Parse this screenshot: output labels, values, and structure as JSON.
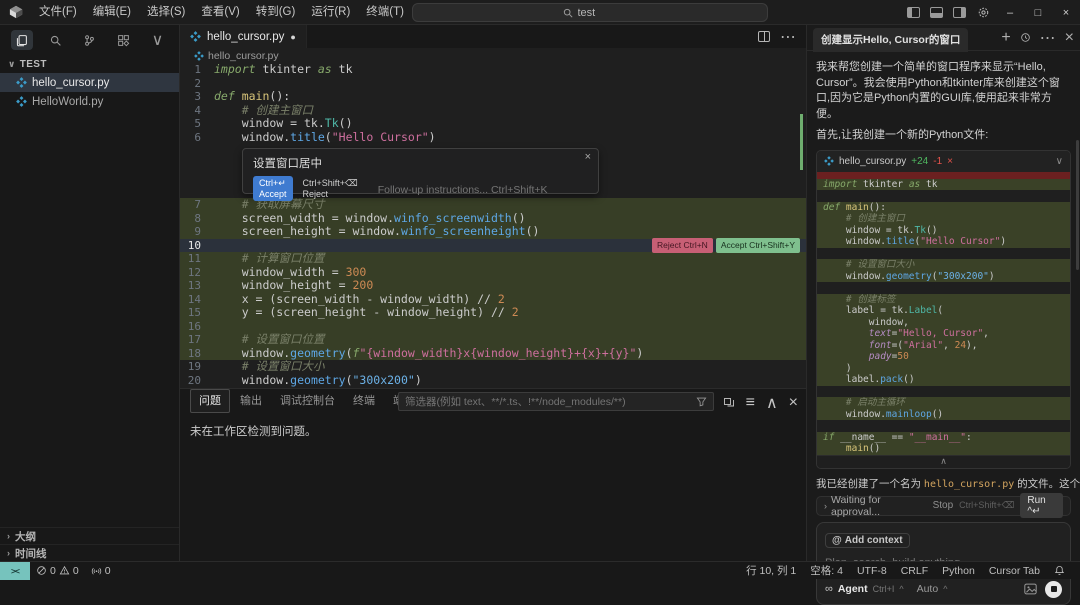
{
  "icons": {
    "close": "×",
    "ellipsis": "⋯",
    "back": "←",
    "forward": "→",
    "minimize": "–",
    "maximize": "□",
    "collapse_up": "∧",
    "chevron_down": "∨",
    "chevron_right": "›",
    "list": "≡",
    "plus": "+",
    "modified_dot": "●",
    "at": "@",
    "infinity": "∞",
    "caret_up": "^",
    "remote": "><"
  },
  "titlebar": {
    "menus": [
      "文件(F)",
      "编辑(E)",
      "选择(S)",
      "查看(V)",
      "转到(G)",
      "运行(R)",
      "终端(T)",
      "⋯"
    ],
    "search_text": "test"
  },
  "sidebar": {
    "explorer_label": "TEST",
    "files": [
      {
        "name": "hello_cursor.py",
        "selected": true
      },
      {
        "name": "HelloWorld.py",
        "selected": false
      }
    ],
    "bottom_sections": [
      "大纲",
      "时间线"
    ]
  },
  "editor": {
    "tab_label": "hello_cursor.py",
    "breadcrumb": "hello_cursor.py",
    "widget": {
      "title": "设置窗口居中",
      "accept_label": "Ctrl+↵ Accept",
      "reject_label": "Ctrl+Shift+⌫ Reject",
      "input_placeholder": "Follow-up instructions... Ctrl+Shift+K"
    },
    "lines_before": [
      {
        "n": 1,
        "t": [
          [
            "kw",
            "import"
          ],
          [
            "txt",
            " tkinter "
          ],
          [
            "kw",
            "as"
          ],
          [
            "txt",
            " tk"
          ]
        ]
      },
      {
        "n": 2,
        "t": []
      },
      {
        "n": 3,
        "t": [
          [
            "kw",
            "def "
          ],
          [
            "fn",
            "main"
          ],
          [
            "txt",
            "():"
          ]
        ]
      },
      {
        "n": 4,
        "t": [
          [
            "com",
            "    # 创建主窗口"
          ]
        ]
      },
      {
        "n": 5,
        "t": [
          [
            "txt",
            "    window = tk."
          ],
          [
            "cls",
            "Tk"
          ],
          [
            "txt",
            "()"
          ]
        ]
      },
      {
        "n": 6,
        "t": [
          [
            "txt",
            "    window."
          ],
          [
            "meth",
            "title"
          ],
          [
            "txt",
            "("
          ],
          [
            "str",
            "\"Hello Cursor\""
          ],
          [
            "txt",
            ")"
          ]
        ]
      }
    ],
    "lines_after": [
      {
        "n": 7,
        "f": "a",
        "t": [
          [
            "com",
            "    # 获取屏幕尺寸"
          ]
        ]
      },
      {
        "n": 8,
        "f": "a",
        "t": [
          [
            "txt",
            "    screen_width = window."
          ],
          [
            "meth",
            "winfo_screenwidth"
          ],
          [
            "txt",
            "()"
          ]
        ]
      },
      {
        "n": 9,
        "f": "a",
        "t": [
          [
            "txt",
            "    screen_height = window."
          ],
          [
            "meth",
            "winfo_screenheight"
          ],
          [
            "txt",
            "()"
          ]
        ]
      },
      {
        "n": 10,
        "f": "ac",
        "t": [],
        "b": [
          {
            "k": "reject",
            "label": "Reject Ctrl+N"
          },
          {
            "k": "accept",
            "label": "Accept Ctrl+Shift+Y"
          }
        ]
      },
      {
        "n": 11,
        "f": "a",
        "t": [
          [
            "com",
            "    # 计算窗口位置"
          ]
        ]
      },
      {
        "n": 12,
        "f": "a",
        "t": [
          [
            "txt",
            "    window_width = "
          ],
          [
            "num",
            "300"
          ]
        ]
      },
      {
        "n": 13,
        "f": "a",
        "t": [
          [
            "txt",
            "    window_height = "
          ],
          [
            "num",
            "200"
          ]
        ]
      },
      {
        "n": 14,
        "f": "a",
        "t": [
          [
            "txt",
            "    x = (screen_width - window_width) // "
          ],
          [
            "num",
            "2"
          ]
        ]
      },
      {
        "n": 15,
        "f": "a",
        "t": [
          [
            "txt",
            "    y = (screen_height - window_height) // "
          ],
          [
            "num",
            "2"
          ]
        ]
      },
      {
        "n": 16,
        "f": "a",
        "t": []
      },
      {
        "n": 17,
        "f": "a",
        "t": [
          [
            "com",
            "    # 设置窗口位置"
          ]
        ]
      },
      {
        "n": 18,
        "f": "a",
        "t": [
          [
            "txt",
            "    window."
          ],
          [
            "meth",
            "geometry"
          ],
          [
            "txt",
            "("
          ],
          [
            "kw",
            "f"
          ],
          [
            "str",
            "\"{window_width}x{window_height}+{x}+{y}\""
          ],
          [
            "txt",
            ")"
          ]
        ]
      },
      {
        "n": 19,
        "f": "",
        "t": [
          [
            "com",
            "    # 设置窗口大小"
          ]
        ]
      },
      {
        "n": 20,
        "f": "",
        "t": [
          [
            "txt",
            "    window."
          ],
          [
            "meth",
            "geometry"
          ],
          [
            "txt",
            "("
          ],
          [
            "str2",
            "\"300x200\""
          ],
          [
            "txt",
            ")"
          ]
        ]
      }
    ]
  },
  "panel": {
    "tabs": [
      {
        "label": "问题",
        "active": true
      },
      {
        "label": "输出",
        "active": false
      },
      {
        "label": "调试控制台",
        "active": false
      },
      {
        "label": "终端",
        "active": false
      },
      {
        "label": "端口",
        "active": false
      }
    ],
    "filter_placeholder": "筛选器(例如 text、**/*.ts、!**/node_modules/**)",
    "message": "未在工作区检测到问题。"
  },
  "chat": {
    "tab_title": "创建显示Hello, Cursor的窗口",
    "p1": "我来帮您创建一个简单的窗口程序来显示“Hello, Cursor”。我会使用Python和tkinter库来创建这个窗口,因为它是Python内置的GUI库,使用起来非常方便。",
    "p2": "首先,让我创建一个新的Python文件:",
    "code_card": {
      "filename": "hello_cursor.py",
      "added": "+24",
      "removed": "-1",
      "close": "×"
    },
    "code_lines": [
      {
        "f": "del",
        "t": []
      },
      {
        "g": true,
        "t": [
          [
            "kw",
            "import"
          ],
          [
            "txt",
            " tkinter "
          ],
          [
            "kw",
            "as"
          ],
          [
            "txt",
            " tk"
          ]
        ]
      },
      {
        "t": []
      },
      {
        "g": true,
        "t": [
          [
            "kw",
            "def "
          ],
          [
            "fn",
            "main"
          ],
          [
            "txt",
            "():"
          ]
        ]
      },
      {
        "g": true,
        "t": [
          [
            "com",
            "    # 创建主窗口"
          ]
        ]
      },
      {
        "g": true,
        "t": [
          [
            "txt",
            "    window = tk."
          ],
          [
            "cls",
            "Tk"
          ],
          [
            "txt",
            "()"
          ]
        ]
      },
      {
        "g": true,
        "t": [
          [
            "txt",
            "    window."
          ],
          [
            "meth",
            "title"
          ],
          [
            "txt",
            "("
          ],
          [
            "str",
            "\"Hello Cursor\""
          ],
          [
            "txt",
            ")"
          ]
        ]
      },
      {
        "t": []
      },
      {
        "g": true,
        "t": [
          [
            "com",
            "    # 设置窗口大小"
          ]
        ]
      },
      {
        "g": true,
        "t": [
          [
            "txt",
            "    window."
          ],
          [
            "meth",
            "geometry"
          ],
          [
            "txt",
            "("
          ],
          [
            "str2",
            "\"300x200\""
          ],
          [
            "txt",
            ")"
          ]
        ]
      },
      {
        "t": []
      },
      {
        "g": true,
        "t": [
          [
            "com",
            "    # 创建标签"
          ]
        ]
      },
      {
        "g": true,
        "t": [
          [
            "txt",
            "    label = tk."
          ],
          [
            "cls",
            "Label"
          ],
          [
            "txt",
            "("
          ]
        ]
      },
      {
        "g": true,
        "t": [
          [
            "txt",
            "        window,"
          ]
        ]
      },
      {
        "g": true,
        "t": [
          [
            "arg",
            "        text"
          ],
          [
            "txt",
            "="
          ],
          [
            "str",
            "\"Hello, Cursor\""
          ],
          [
            "txt",
            ","
          ]
        ]
      },
      {
        "g": true,
        "t": [
          [
            "arg",
            "        font"
          ],
          [
            "txt",
            "=("
          ],
          [
            "str",
            "\"Arial\""
          ],
          [
            "txt",
            ", "
          ],
          [
            "num",
            "24"
          ],
          [
            "txt",
            "),"
          ]
        ]
      },
      {
        "g": true,
        "t": [
          [
            "arg",
            "        pady"
          ],
          [
            "txt",
            "="
          ],
          [
            "num",
            "50"
          ]
        ]
      },
      {
        "g": true,
        "t": [
          [
            "txt",
            "    )"
          ]
        ]
      },
      {
        "g": true,
        "t": [
          [
            "txt",
            "    label."
          ],
          [
            "meth",
            "pack"
          ],
          [
            "txt",
            "()"
          ]
        ]
      },
      {
        "t": []
      },
      {
        "g": true,
        "t": [
          [
            "com",
            "    # 启动主循环"
          ]
        ]
      },
      {
        "g": true,
        "t": [
          [
            "txt",
            "    window."
          ],
          [
            "meth",
            "mainloop"
          ],
          [
            "txt",
            "()"
          ]
        ]
      },
      {
        "t": []
      },
      {
        "g": true,
        "t": [
          [
            "kw",
            "if"
          ],
          [
            "txt",
            " __name__ == "
          ],
          [
            "str",
            "\"__main__\""
          ],
          [
            "txt",
            ":"
          ]
        ]
      },
      {
        "g": true,
        "t": [
          [
            "txt",
            "    "
          ],
          [
            "fn",
            "main"
          ],
          [
            "txt",
            "()"
          ]
        ]
      }
    ],
    "p3_before": "我已经创建了一个名为 ",
    "p3_code": "hello_cursor.py",
    "p3_after": " 的文件。这个程序会",
    "approval": {
      "text": "Waiting for approval...",
      "stop_label": "Stop",
      "stop_keys": "Ctrl+Shift+⌫",
      "run_label": "Run ^↵"
    },
    "input": {
      "add_context": "Add context",
      "placeholder": "Plan, search, build anything",
      "agent_label": "Agent",
      "agent_keys": "Ctrl+I",
      "mode": "Auto"
    }
  },
  "statusbar": {
    "errors": "0",
    "warnings": "0",
    "ports": "0",
    "right_items": [
      "行 10, 列 1",
      "空格: 4",
      "UTF-8",
      "CRLF",
      "Python",
      "Cursor Tab"
    ]
  }
}
